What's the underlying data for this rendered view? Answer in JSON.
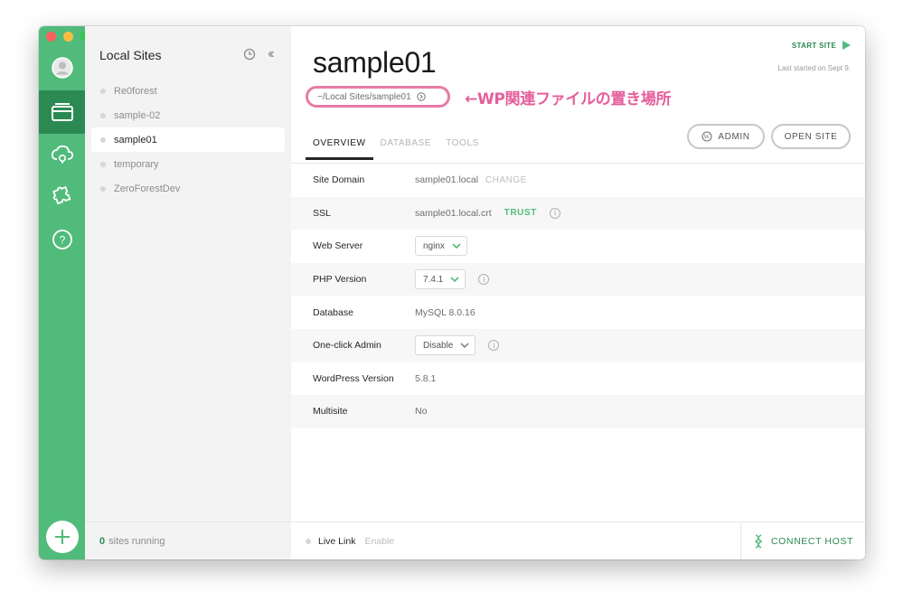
{
  "colors": {
    "brand_green": "#51bb7b",
    "dark_green": "#2b8a52",
    "annotation_pink": "#e55e9a"
  },
  "sidebar": {
    "icons": [
      "avatar-icon",
      "sites-icon",
      "cloud-icon",
      "addons-icon",
      "help-icon"
    ],
    "add_icon": "plus-icon"
  },
  "sites_panel": {
    "title": "Local Sites",
    "items": [
      {
        "name": "Re0forest"
      },
      {
        "name": "sample-02"
      },
      {
        "name": "sample01",
        "selected": true
      },
      {
        "name": "temporary"
      },
      {
        "name": "ZeroForestDev"
      }
    ],
    "footer": {
      "count": "0",
      "label": "sites running"
    }
  },
  "main": {
    "title": "sample01",
    "start_site": "START SITE",
    "last_started": "Last started on Sept 9.",
    "path": "~/Local Sites/sample01",
    "annotation": "←WP関連ファイルの置き場所",
    "tabs": [
      "OVERVIEW",
      "DATABASE",
      "TOOLS"
    ],
    "admin_label": "ADMIN",
    "open_site_label": "OPEN SITE",
    "rows": {
      "site_domain": {
        "label": "Site Domain",
        "value": "sample01.local",
        "action": "CHANGE"
      },
      "ssl": {
        "label": "SSL",
        "value": "sample01.local.crt",
        "action": "TRUST"
      },
      "web_server": {
        "label": "Web Server",
        "value": "nginx"
      },
      "php_version": {
        "label": "PHP Version",
        "value": "7.4.1"
      },
      "database": {
        "label": "Database",
        "value": "MySQL 8.0.16"
      },
      "one_click_admin": {
        "label": "One-click Admin",
        "value": "Disable"
      },
      "wp_version": {
        "label": "WordPress Version",
        "value": "5.8.1"
      },
      "multisite": {
        "label": "Multisite",
        "value": "No"
      }
    },
    "footer": {
      "live_link": "Live Link",
      "enable": "Enable",
      "connect_host": "CONNECT HOST"
    }
  }
}
